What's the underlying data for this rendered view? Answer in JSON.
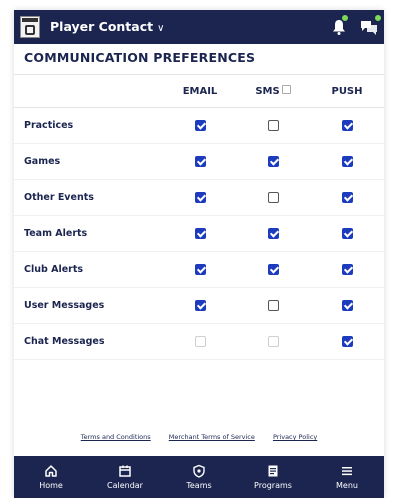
{
  "header": {
    "title": "Player Contact",
    "dropdown_icon": "chevron-down-icon",
    "notification_icon": "bell-icon",
    "chat_icon": "chat-bubbles-icon",
    "badge_color": "#7ed957",
    "bg_color": "#1b2550"
  },
  "section_title": "COMMUNICATION PREFERENCES",
  "columns": [
    "EMAIL",
    "SMS",
    "PUSH"
  ],
  "rows": [
    {
      "label": "Practices",
      "email": true,
      "sms": false,
      "push": true
    },
    {
      "label": "Games",
      "email": true,
      "sms": true,
      "push": true
    },
    {
      "label": "Other Events",
      "email": true,
      "sms": false,
      "push": true
    },
    {
      "label": "Team Alerts",
      "email": true,
      "sms": true,
      "push": true
    },
    {
      "label": "Club Alerts",
      "email": true,
      "sms": true,
      "push": true
    },
    {
      "label": "User Messages",
      "email": true,
      "sms": false,
      "push": true
    },
    {
      "label": "Chat Messages",
      "email": false,
      "sms": false,
      "push": true,
      "email_disabled": true,
      "sms_disabled": true
    }
  ],
  "footer_links": [
    "Terms and Conditions",
    "Merchant Terms of Service",
    "Privacy Policy"
  ],
  "nav": [
    {
      "label": "Home",
      "icon": "home-icon"
    },
    {
      "label": "Calendar",
      "icon": "calendar-icon"
    },
    {
      "label": "Teams",
      "icon": "shield-icon"
    },
    {
      "label": "Programs",
      "icon": "clipboard-icon"
    },
    {
      "label": "Menu",
      "icon": "hamburger-menu-icon"
    }
  ],
  "accent_color": "#1c3bbd"
}
